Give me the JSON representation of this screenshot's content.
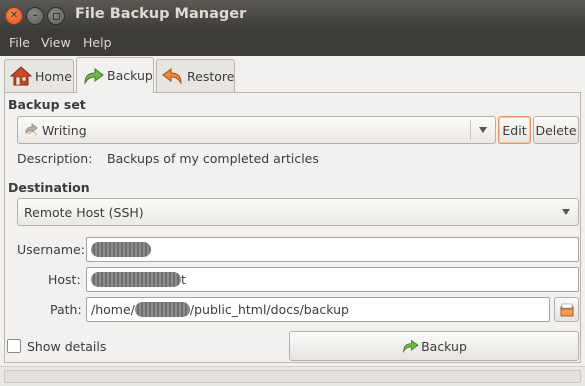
{
  "window": {
    "title": "File Backup Manager"
  },
  "menu": {
    "items": [
      "File",
      "View",
      "Help"
    ]
  },
  "tabs": [
    {
      "label": "Home",
      "icon": "home-icon",
      "active": false
    },
    {
      "label": "Backup",
      "icon": "backup-arrow-icon",
      "active": true
    },
    {
      "label": "Restore",
      "icon": "restore-arrow-icon",
      "active": false
    }
  ],
  "backup_set": {
    "section_label": "Backup set",
    "selected": "Writing",
    "edit_label": "Edit",
    "delete_label": "Delete",
    "description_label": "Description:",
    "description_value": "Backups of my completed articles"
  },
  "destination": {
    "section_label": "Destination",
    "selected": "Remote Host (SSH)",
    "username_label": "Username:",
    "host_label": "Host:",
    "host_suffix": "t",
    "path_label": "Path:",
    "path_prefix": "/home/",
    "path_suffix": "/public_html/docs/backup"
  },
  "footer": {
    "show_details_label": "Show details",
    "show_details_checked": false,
    "backup_button_label": "Backup"
  },
  "colors": {
    "titlebar": "#3c3b37",
    "accent_orange": "#e0521f",
    "backup_arrow_green": "#6aa84f",
    "restore_arrow_orange": "#e8833a"
  }
}
